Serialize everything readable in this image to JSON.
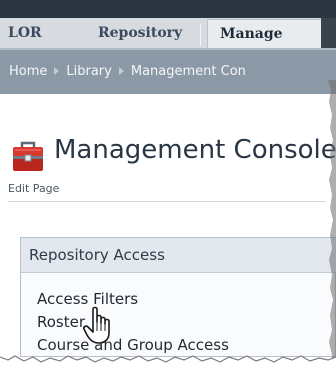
{
  "tabs": [
    {
      "label": "LOR"
    },
    {
      "label": "Repository"
    },
    {
      "label": "Manage"
    }
  ],
  "breadcrumb": [
    "Home",
    "Library",
    "Management Con"
  ],
  "page": {
    "title": "Management Console",
    "edit_label": "Edit Page"
  },
  "panel": {
    "title": "Repository Access",
    "links": [
      "Access Filters",
      "Roster",
      "Course and Group Access"
    ]
  },
  "colors": {
    "tab_bar": "#d7dbe0",
    "breadcrumb_bar": "#8b99a6",
    "panel_header": "#e3e8ee"
  },
  "icons": [
    "toolbox-icon",
    "hand-cursor-icon"
  ]
}
